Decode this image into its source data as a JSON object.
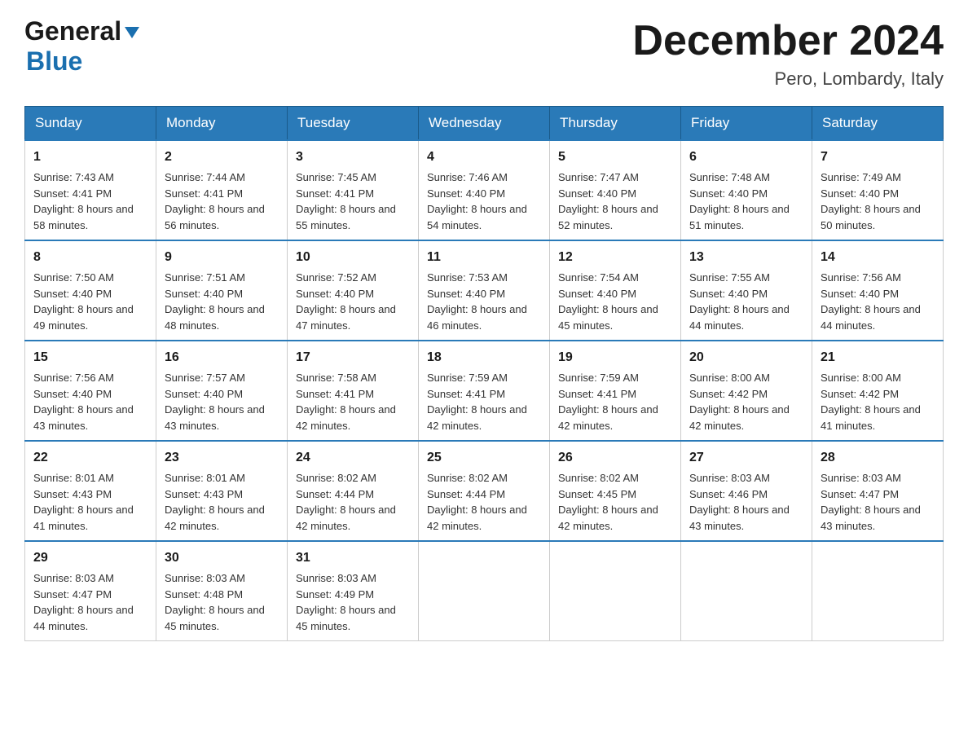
{
  "header": {
    "logo_general": "General",
    "logo_blue": "Blue",
    "month_title": "December 2024",
    "location": "Pero, Lombardy, Italy"
  },
  "weekdays": [
    "Sunday",
    "Monday",
    "Tuesday",
    "Wednesday",
    "Thursday",
    "Friday",
    "Saturday"
  ],
  "weeks": [
    [
      {
        "day": "1",
        "sunrise": "7:43 AM",
        "sunset": "4:41 PM",
        "daylight": "8 hours and 58 minutes."
      },
      {
        "day": "2",
        "sunrise": "7:44 AM",
        "sunset": "4:41 PM",
        "daylight": "8 hours and 56 minutes."
      },
      {
        "day": "3",
        "sunrise": "7:45 AM",
        "sunset": "4:41 PM",
        "daylight": "8 hours and 55 minutes."
      },
      {
        "day": "4",
        "sunrise": "7:46 AM",
        "sunset": "4:40 PM",
        "daylight": "8 hours and 54 minutes."
      },
      {
        "day": "5",
        "sunrise": "7:47 AM",
        "sunset": "4:40 PM",
        "daylight": "8 hours and 52 minutes."
      },
      {
        "day": "6",
        "sunrise": "7:48 AM",
        "sunset": "4:40 PM",
        "daylight": "8 hours and 51 minutes."
      },
      {
        "day": "7",
        "sunrise": "7:49 AM",
        "sunset": "4:40 PM",
        "daylight": "8 hours and 50 minutes."
      }
    ],
    [
      {
        "day": "8",
        "sunrise": "7:50 AM",
        "sunset": "4:40 PM",
        "daylight": "8 hours and 49 minutes."
      },
      {
        "day": "9",
        "sunrise": "7:51 AM",
        "sunset": "4:40 PM",
        "daylight": "8 hours and 48 minutes."
      },
      {
        "day": "10",
        "sunrise": "7:52 AM",
        "sunset": "4:40 PM",
        "daylight": "8 hours and 47 minutes."
      },
      {
        "day": "11",
        "sunrise": "7:53 AM",
        "sunset": "4:40 PM",
        "daylight": "8 hours and 46 minutes."
      },
      {
        "day": "12",
        "sunrise": "7:54 AM",
        "sunset": "4:40 PM",
        "daylight": "8 hours and 45 minutes."
      },
      {
        "day": "13",
        "sunrise": "7:55 AM",
        "sunset": "4:40 PM",
        "daylight": "8 hours and 44 minutes."
      },
      {
        "day": "14",
        "sunrise": "7:56 AM",
        "sunset": "4:40 PM",
        "daylight": "8 hours and 44 minutes."
      }
    ],
    [
      {
        "day": "15",
        "sunrise": "7:56 AM",
        "sunset": "4:40 PM",
        "daylight": "8 hours and 43 minutes."
      },
      {
        "day": "16",
        "sunrise": "7:57 AM",
        "sunset": "4:40 PM",
        "daylight": "8 hours and 43 minutes."
      },
      {
        "day": "17",
        "sunrise": "7:58 AM",
        "sunset": "4:41 PM",
        "daylight": "8 hours and 42 minutes."
      },
      {
        "day": "18",
        "sunrise": "7:59 AM",
        "sunset": "4:41 PM",
        "daylight": "8 hours and 42 minutes."
      },
      {
        "day": "19",
        "sunrise": "7:59 AM",
        "sunset": "4:41 PM",
        "daylight": "8 hours and 42 minutes."
      },
      {
        "day": "20",
        "sunrise": "8:00 AM",
        "sunset": "4:42 PM",
        "daylight": "8 hours and 42 minutes."
      },
      {
        "day": "21",
        "sunrise": "8:00 AM",
        "sunset": "4:42 PM",
        "daylight": "8 hours and 41 minutes."
      }
    ],
    [
      {
        "day": "22",
        "sunrise": "8:01 AM",
        "sunset": "4:43 PM",
        "daylight": "8 hours and 41 minutes."
      },
      {
        "day": "23",
        "sunrise": "8:01 AM",
        "sunset": "4:43 PM",
        "daylight": "8 hours and 42 minutes."
      },
      {
        "day": "24",
        "sunrise": "8:02 AM",
        "sunset": "4:44 PM",
        "daylight": "8 hours and 42 minutes."
      },
      {
        "day": "25",
        "sunrise": "8:02 AM",
        "sunset": "4:44 PM",
        "daylight": "8 hours and 42 minutes."
      },
      {
        "day": "26",
        "sunrise": "8:02 AM",
        "sunset": "4:45 PM",
        "daylight": "8 hours and 42 minutes."
      },
      {
        "day": "27",
        "sunrise": "8:03 AM",
        "sunset": "4:46 PM",
        "daylight": "8 hours and 43 minutes."
      },
      {
        "day": "28",
        "sunrise": "8:03 AM",
        "sunset": "4:47 PM",
        "daylight": "8 hours and 43 minutes."
      }
    ],
    [
      {
        "day": "29",
        "sunrise": "8:03 AM",
        "sunset": "4:47 PM",
        "daylight": "8 hours and 44 minutes."
      },
      {
        "day": "30",
        "sunrise": "8:03 AM",
        "sunset": "4:48 PM",
        "daylight": "8 hours and 45 minutes."
      },
      {
        "day": "31",
        "sunrise": "8:03 AM",
        "sunset": "4:49 PM",
        "daylight": "8 hours and 45 minutes."
      },
      null,
      null,
      null,
      null
    ]
  ]
}
